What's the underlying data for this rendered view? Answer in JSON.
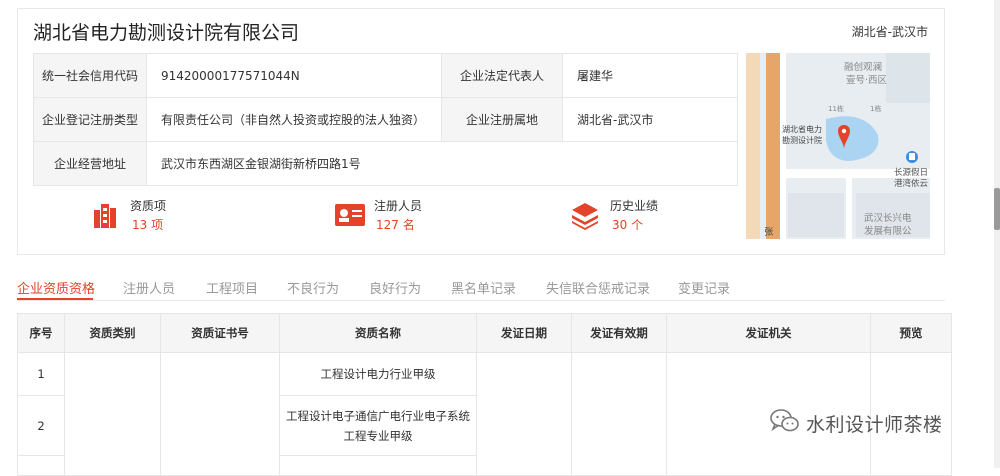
{
  "company": {
    "name": "湖北省电力勘测设计院有限公司",
    "region": "湖北省-武汉市"
  },
  "info": {
    "credit_code_label": "统一社会信用代码",
    "credit_code": "91420000177571044N",
    "legal_rep_label": "企业法定代表人",
    "legal_rep": "屠建华",
    "reg_type_label": "企业登记注册类型",
    "reg_type": "有限责任公司（非自然人投资或控股的法人独资）",
    "reg_place_label": "企业注册属地",
    "reg_place": "湖北省-武汉市",
    "address_label": "企业经营地址",
    "address": "武汉市东西湖区金银湖街新桥四路1号"
  },
  "map": {
    "labels": [
      "融创观澜",
      "壹号·西区",
      "11栋",
      "1栋",
      "湖北省电力",
      "勘测设计院",
      "长源假日",
      "港湾依云",
      "武汉长兴电",
      "发展有限公",
      "张"
    ]
  },
  "stats": [
    {
      "label": "资质项",
      "value": "13 项",
      "icon": "building-icon"
    },
    {
      "label": "注册人员",
      "value": "127 名",
      "icon": "id-card-icon"
    },
    {
      "label": "历史业绩",
      "value": "30 个",
      "icon": "layers-icon"
    }
  ],
  "tabs": [
    "企业资质资格",
    "注册人员",
    "工程项目",
    "不良行为",
    "良好行为",
    "黑名单记录",
    "失信联合惩戒记录",
    "变更记录"
  ],
  "table": {
    "headers": [
      "序号",
      "资质类别",
      "资质证书号",
      "资质名称",
      "发证日期",
      "发证有效期",
      "发证机关",
      "预览"
    ],
    "rows": [
      {
        "index": "1",
        "name": "工程设计电力行业甲级"
      },
      {
        "index": "2",
        "name_line1": "工程设计电子通信广电行业电子系统",
        "name_line2": "工程专业甲级"
      }
    ]
  },
  "watermark": {
    "text": "水利设计师茶楼",
    "icon": "wechat-icon"
  },
  "colors": {
    "accent": "#e2432a",
    "label_bg": "#f5f5f5",
    "border": "#e6e6e6"
  }
}
